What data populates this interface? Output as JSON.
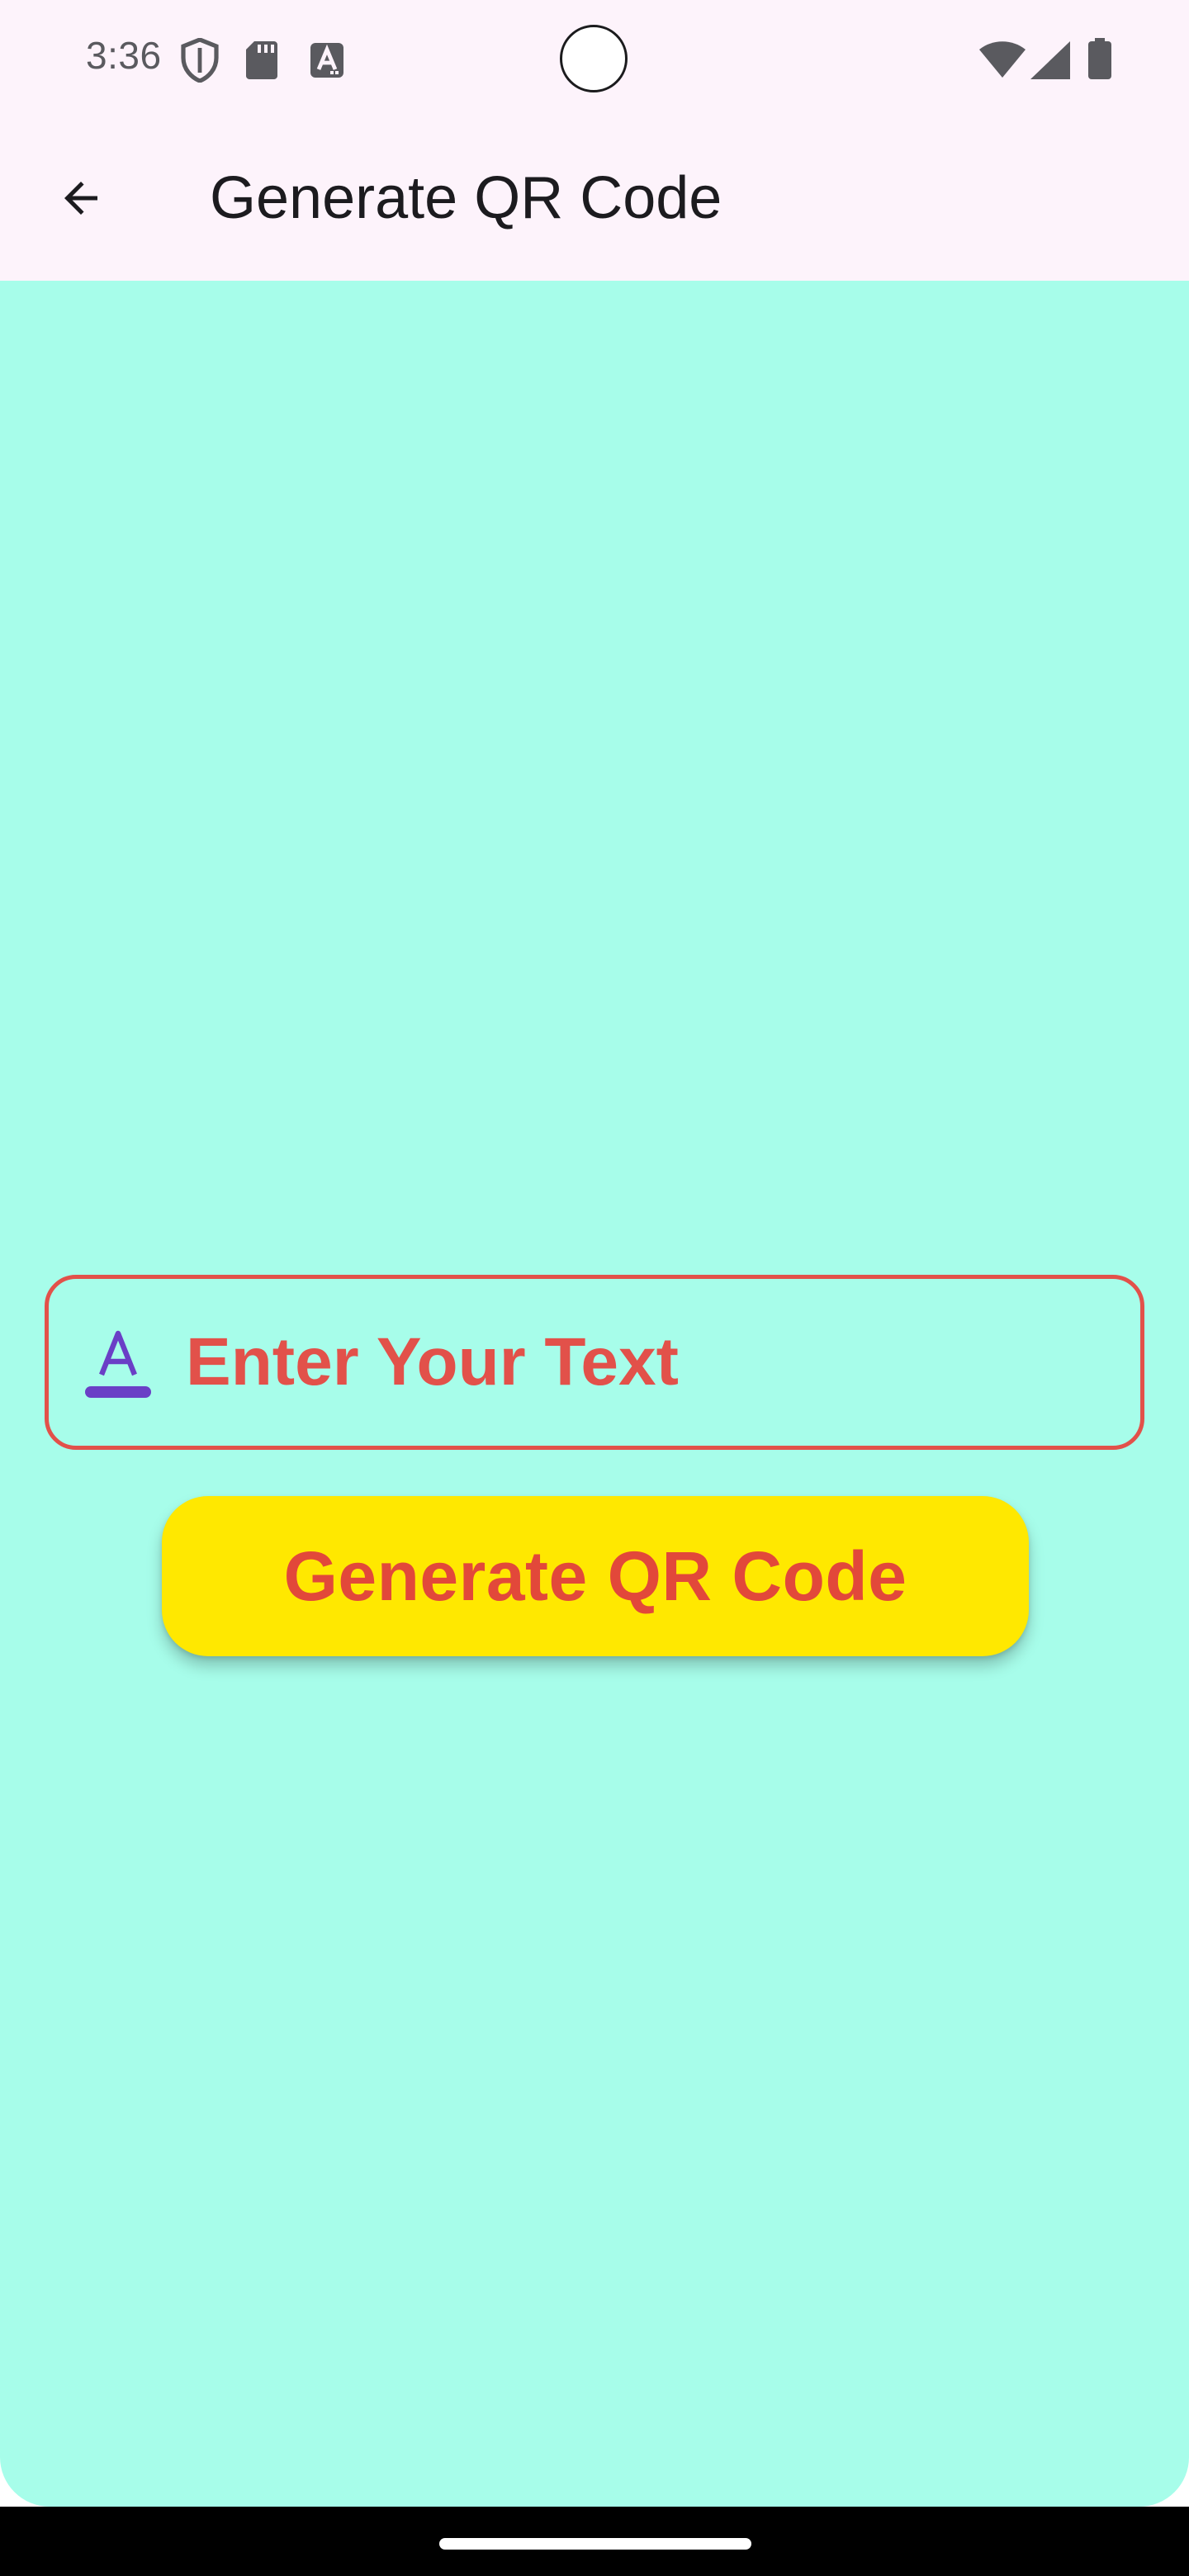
{
  "status_bar": {
    "time": "3:36",
    "icons_left": [
      "shield-icon",
      "sd-card-icon",
      "font-a-icon"
    ],
    "icons_right": [
      "wifi-icon",
      "cell-signal-icon",
      "battery-icon"
    ]
  },
  "app_bar": {
    "title": "Generate QR Code",
    "back_icon": "arrow-back-icon"
  },
  "form": {
    "input_placeholder": "Enter Your Text",
    "input_value": "",
    "input_icon": "text-format-icon",
    "generate_label": "Generate QR Code"
  },
  "colors": {
    "screen_background": "#a7fdea",
    "app_bar_background": "#fdf3fb",
    "accent_red": "#e2514a",
    "button_yellow": "#ffe800",
    "icon_purple": "#6a3fc6"
  }
}
